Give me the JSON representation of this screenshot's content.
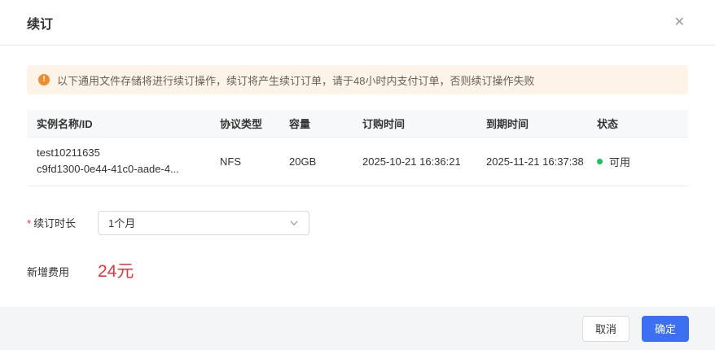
{
  "dialog": {
    "title": "续订",
    "close_glyph": "✕"
  },
  "alert": {
    "icon": "warning-circle-icon",
    "icon_glyph": "!",
    "text": "以下通用文件存储将进行续订操作，续订将产生续订订单，请于48小时内支付订单，否则续订操作失败"
  },
  "table": {
    "columns": [
      "实例名称/ID",
      "协议类型",
      "容量",
      "订购时间",
      "到期时间",
      "状态"
    ],
    "rows": [
      {
        "name": "test10211635",
        "id": "c9fd1300-0e44-41c0-aade-4...",
        "protocol": "NFS",
        "capacity": "20GB",
        "order_time": "2025-10-21 16:36:21",
        "expire_time": "2025-11-21 16:37:38",
        "status": "可用"
      }
    ]
  },
  "form": {
    "duration_required_mark": "*",
    "duration_label": "续订时长",
    "duration_value": "1个月",
    "fee_label": "新增费用",
    "fee_value": "24元"
  },
  "footer": {
    "cancel_label": "取消",
    "confirm_label": "确定"
  },
  "colors": {
    "accent_blue": "#3d6ff2",
    "status_green": "#1dbf60",
    "fee_red": "#e63540",
    "warn_orange": "#ef8b33",
    "banner_bg": "#fdf3e7",
    "footer_bg": "#f4f5f7"
  }
}
